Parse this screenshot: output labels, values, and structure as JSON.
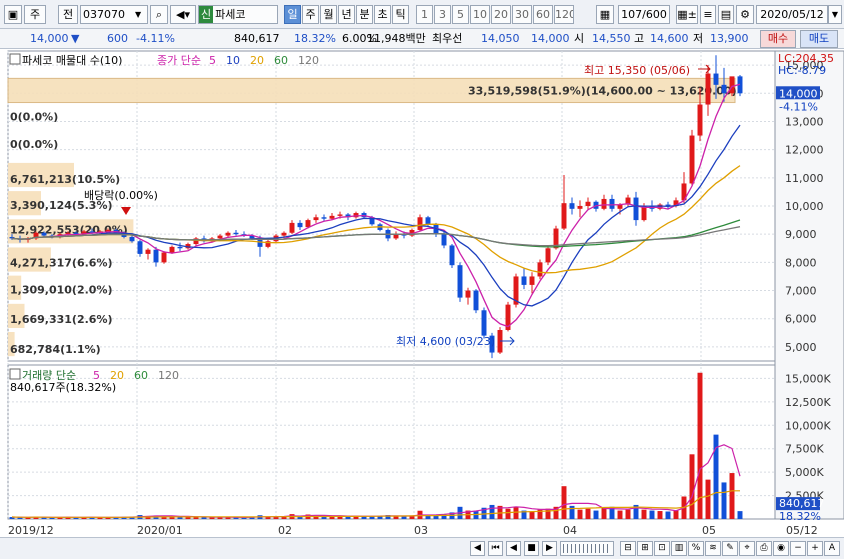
{
  "toolbar": {
    "market": "주",
    "period_prefix": "전",
    "code": "037070",
    "badge": "신",
    "name": "파세코",
    "modes": [
      "일",
      "주",
      "월",
      "년",
      "분",
      "초",
      "틱"
    ],
    "active_mode": "일",
    "intervals": [
      "1",
      "3",
      "5",
      "10",
      "20",
      "30",
      "60",
      "120"
    ],
    "count": "107/600",
    "date": "2020/05/12"
  },
  "quote": {
    "price": "14,000",
    "arrow": "▼",
    "change": "600",
    "change_pct": "-4.11%",
    "volume": "840,617",
    "vol_ratio": "18.32%",
    "turnover_pct": "6.00%",
    "amount": "11,948백만",
    "best_label": "최우선",
    "best_ask": "14,050",
    "best_bid": "14,000",
    "open_label": "시",
    "open": "14,550",
    "high_label": "고",
    "high": "14,600",
    "low_label": "저",
    "low": "13,900",
    "buy": "매수",
    "sell": "매도"
  },
  "price_panel": {
    "title": "파세코 매물대 수(10)",
    "legend_prefix": "종가 단순",
    "legend_periods": [
      "5",
      "10",
      "20",
      "60",
      "120"
    ],
    "lc": "LC:204.35",
    "hc": "HC:-8.79",
    "current_price": "14,000",
    "current_pct": "-4.11%",
    "axis_labels": [
      "15,000",
      "14,000",
      "13,000",
      "12,000",
      "11,000",
      "10,000",
      "9,000",
      "8,000",
      "7,000",
      "6,000",
      "5,000"
    ],
    "high_note": "최고 15,350 (05/06)",
    "low_note": "최저 4,600 (03/23)",
    "event_note": "배당락(0.00%)",
    "profile": [
      {
        "label": "33,519,598(51.9%)(14,600.00 ~ 13,620.00)",
        "frac": 1.0
      },
      {
        "label": "0(0.0%)",
        "frac": 0.0
      },
      {
        "label": "0(0.0%)",
        "frac": 0.0
      },
      {
        "label": "6,761,213(10.5%)",
        "frac": 0.2
      },
      {
        "label": "3,390,124(5.3%)",
        "frac": 0.1
      },
      {
        "label": "12,922,553(20.0%)",
        "frac": 0.38
      },
      {
        "label": "4,271,317(6.6%)",
        "frac": 0.13
      },
      {
        "label": "1,309,010(2.0%)",
        "frac": 0.04
      },
      {
        "label": "1,669,331(2.6%)",
        "frac": 0.05
      },
      {
        "label": "682,784(1.1%)",
        "frac": 0.02
      }
    ]
  },
  "volume_panel": {
    "title": "거래량 단순",
    "legend_periods": [
      "5",
      "20",
      "60",
      "120"
    ],
    "value_note": "840,617주(18.32%)",
    "axis_labels": [
      "15,000K",
      "12,500K",
      "10,000K",
      "7,500K",
      "5,000K",
      "2,500K"
    ],
    "current": "840,617",
    "current_pct": "18.32%"
  },
  "x_axis": [
    "2019/12",
    "2020/01",
    "02",
    "03",
    "04",
    "05",
    "05/12"
  ],
  "chart_data": {
    "type": "candlestick",
    "ylim": [
      4500,
      15500
    ],
    "volume_ylim": [
      0,
      16000000
    ],
    "candles": [
      [
        8900,
        9000,
        8800,
        8850
      ],
      [
        8850,
        8950,
        8700,
        8800
      ],
      [
        8800,
        8900,
        8700,
        8850
      ],
      [
        8850,
        9100,
        8800,
        9050
      ],
      [
        9050,
        9100,
        8900,
        8950
      ],
      [
        8950,
        9000,
        8850,
        8900
      ],
      [
        8900,
        9050,
        8850,
        9000
      ],
      [
        9000,
        9100,
        8950,
        9050
      ],
      [
        9050,
        9100,
        8950,
        9000
      ],
      [
        9000,
        9150,
        8950,
        9100
      ],
      [
        9100,
        9200,
        9000,
        9050
      ],
      [
        9050,
        9150,
        8950,
        9100
      ],
      [
        9100,
        9200,
        9050,
        9150
      ],
      [
        9150,
        9200,
        9000,
        9050
      ],
      [
        9050,
        9100,
        8850,
        8900
      ],
      [
        8900,
        8950,
        8700,
        8750
      ],
      [
        8750,
        8800,
        8200,
        8300
      ],
      [
        8300,
        8500,
        8100,
        8450
      ],
      [
        8450,
        8550,
        7850,
        8000
      ],
      [
        8000,
        8400,
        7950,
        8350
      ],
      [
        8350,
        8600,
        8300,
        8550
      ],
      [
        8550,
        8700,
        8400,
        8500
      ],
      [
        8500,
        8700,
        8450,
        8650
      ],
      [
        8650,
        8900,
        8600,
        8850
      ],
      [
        8850,
        8950,
        8700,
        8750
      ],
      [
        8750,
        8900,
        8700,
        8850
      ],
      [
        8850,
        9000,
        8750,
        8950
      ],
      [
        8950,
        9100,
        8900,
        9050
      ],
      [
        9050,
        9150,
        8950,
        9000
      ],
      [
        9000,
        9100,
        8900,
        8950
      ],
      [
        8950,
        9000,
        8800,
        8850
      ],
      [
        8850,
        8950,
        8200,
        8550
      ],
      [
        8550,
        8800,
        8500,
        8750
      ],
      [
        8750,
        9000,
        8700,
        8950
      ],
      [
        8950,
        9100,
        8850,
        9050
      ],
      [
        9050,
        9500,
        9000,
        9400
      ],
      [
        9400,
        9500,
        9150,
        9250
      ],
      [
        9250,
        9550,
        9200,
        9500
      ],
      [
        9500,
        9700,
        9400,
        9600
      ],
      [
        9600,
        9700,
        9450,
        9550
      ],
      [
        9550,
        9750,
        9500,
        9650
      ],
      [
        9650,
        9800,
        9550,
        9700
      ],
      [
        9700,
        9750,
        9500,
        9600
      ],
      [
        9600,
        9800,
        9550,
        9750
      ],
      [
        9750,
        9800,
        9550,
        9600
      ],
      [
        9600,
        9650,
        9300,
        9350
      ],
      [
        9350,
        9400,
        9100,
        9150
      ],
      [
        9150,
        9200,
        8750,
        8850
      ],
      [
        8850,
        9100,
        8800,
        9000
      ],
      [
        9000,
        9100,
        8850,
        8950
      ],
      [
        8950,
        9200,
        8900,
        9150
      ],
      [
        9150,
        9700,
        9100,
        9600
      ],
      [
        9600,
        9650,
        9300,
        9350
      ],
      [
        9350,
        9400,
        8900,
        9000
      ],
      [
        9000,
        9100,
        8500,
        8600
      ],
      [
        8600,
        8650,
        7800,
        7900
      ],
      [
        7900,
        8000,
        6600,
        6750
      ],
      [
        6750,
        7100,
        6500,
        7000
      ],
      [
        7000,
        7050,
        6200,
        6300
      ],
      [
        6300,
        6400,
        5300,
        5400
      ],
      [
        5400,
        5500,
        4600,
        4800
      ],
      [
        4800,
        5700,
        4750,
        5600
      ],
      [
        5600,
        6600,
        5550,
        6500
      ],
      [
        6500,
        7600,
        6400,
        7500
      ],
      [
        7500,
        7800,
        7050,
        7200
      ],
      [
        7200,
        7650,
        6900,
        7500
      ],
      [
        7500,
        8100,
        7400,
        8000
      ],
      [
        8000,
        8600,
        7900,
        8500
      ],
      [
        8500,
        9300,
        8450,
        9200
      ],
      [
        9200,
        11100,
        9150,
        10100
      ],
      [
        10100,
        10300,
        9700,
        9900
      ],
      [
        9900,
        10200,
        9600,
        10000
      ],
      [
        10000,
        10300,
        9850,
        10150
      ],
      [
        10150,
        10200,
        9800,
        9900
      ],
      [
        9900,
        10400,
        9850,
        10250
      ],
      [
        10250,
        10400,
        9800,
        9900
      ],
      [
        9900,
        10100,
        9700,
        10050
      ],
      [
        10050,
        10400,
        9950,
        10300
      ],
      [
        10300,
        10500,
        9300,
        9500
      ],
      [
        9500,
        10100,
        9450,
        10000
      ],
      [
        10000,
        10200,
        9800,
        9900
      ],
      [
        9900,
        10100,
        9850,
        10050
      ],
      [
        10050,
        10150,
        9900,
        10000
      ],
      [
        10000,
        10300,
        9950,
        10200
      ],
      [
        10200,
        11200,
        10100,
        10800
      ],
      [
        10800,
        12700,
        10700,
        12500
      ],
      [
        12500,
        14200,
        12300,
        13600
      ],
      [
        13600,
        15000,
        13200,
        14700
      ],
      [
        14700,
        15350,
        13800,
        14300
      ],
      [
        14300,
        14900,
        13700,
        14000
      ],
      [
        14000,
        14550,
        13900,
        14600
      ],
      [
        14600,
        14650,
        13900,
        14000
      ]
    ],
    "volumes": [
      210000,
      180000,
      160000,
      240000,
      150000,
      140000,
      190000,
      220000,
      170000,
      200000,
      180000,
      160000,
      190000,
      150000,
      230000,
      260000,
      420000,
      300000,
      380000,
      290000,
      260000,
      200000,
      230000,
      250000,
      180000,
      170000,
      190000,
      210000,
      160000,
      150000,
      180000,
      400000,
      260000,
      230000,
      250000,
      520000,
      310000,
      480000,
      350000,
      290000,
      330000,
      300000,
      260000,
      340000,
      280000,
      310000,
      350000,
      420000,
      280000,
      260000,
      300000,
      880000,
      420000,
      380000,
      520000,
      700000,
      1300000,
      900000,
      850000,
      1200000,
      1500000,
      1400000,
      1100000,
      1300000,
      900000,
      800000,
      1000000,
      1100000,
      1300000,
      3500000,
      1400000,
      1000000,
      1100000,
      900000,
      1200000,
      1300000,
      900000,
      1000000,
      1500000,
      1000000,
      900000,
      850000,
      800000,
      900000,
      2400000,
      6900000,
      15600000,
      4200000,
      9000000,
      3900000,
      4900000,
      840617
    ]
  }
}
